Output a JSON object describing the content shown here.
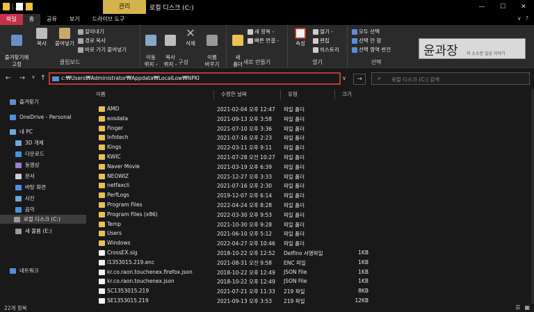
{
  "titlebar": {
    "manage_tab": "관리",
    "title": "로컬 디스크 (C:)",
    "minimize": "—",
    "maximize": "☐",
    "close": "✕"
  },
  "tabs": [
    "파일",
    "홈",
    "공유",
    "보기",
    "드라이브 도구"
  ],
  "ribbon_right": {
    "collapse": "∨",
    "help": "?"
  },
  "ribbon": {
    "clipboard": {
      "pin": "즐겨찾기에\n고정",
      "copy": "복사",
      "paste": "붙여넣기",
      "cut": "잘라내기",
      "copy_path": "경로 복사",
      "paste_shortcut": "바로 가기 붙여넣기",
      "label": "클립보드"
    },
    "organize": {
      "move_to": "이동\n위치 -",
      "copy_to": "복사\n위치 -",
      "delete": "삭제",
      "rename": "이름\n바꾸기",
      "label": "구성"
    },
    "new": {
      "new_folder": "새\n폴더",
      "new_item": "새 항목 -",
      "easy_access": "빠른 연결 -",
      "label": "새로 만들기"
    },
    "open": {
      "properties": "속성",
      "open": "열기 -",
      "edit": "편집",
      "history": "히스토리",
      "label": "열기"
    },
    "select": {
      "select_all": "모두 선택",
      "select_none": "선택 안 함",
      "invert": "선택 영역 반전",
      "label": "선택"
    }
  },
  "logo": {
    "main": "윤과장",
    "sub": "의 소소한 일상 이야기"
  },
  "address": {
    "back": "←",
    "forward": "→",
    "recent": "∨",
    "up": "↑",
    "path": "c:₩Users₩Administrator₩Appdata₩LocalLow₩NPKI",
    "dropdown": "∨",
    "go": "→",
    "search_placeholder": "로컬 디스크 (C:) 검색"
  },
  "nav": {
    "quick_access": "즐겨찾기",
    "onedrive": "OneDrive - Personal",
    "this_pc": "내 PC",
    "objects3d": "3D 개체",
    "downloads": "다운로드",
    "videos": "동영상",
    "documents": "문서",
    "desktop": "바탕 화면",
    "pictures": "사진",
    "music": "음악",
    "local_disk": "로컬 디스크 (C:)",
    "new_volume": "새 볼륨 (E:)",
    "network": "네트워크"
  },
  "columns": {
    "name": "이름",
    "date": "수정한 날짜",
    "type": "유형",
    "size": "크기"
  },
  "files": [
    {
      "name": "AMD",
      "date": "2021-02-04 오후 12:47",
      "type": "파일 폴더",
      "size": "",
      "kind": "folder"
    },
    {
      "name": "eosdata",
      "date": "2021-09-13 오후 3:58",
      "type": "파일 폴더",
      "size": "",
      "kind": "folder"
    },
    {
      "name": "Finger",
      "date": "2021-07-10 오후 3:36",
      "type": "파일 폴더",
      "size": "",
      "kind": "folder"
    },
    {
      "name": "Infotech",
      "date": "2021-07-16 오후 2:23",
      "type": "파일 폴더",
      "size": "",
      "kind": "folder"
    },
    {
      "name": "Kings",
      "date": "2022-03-11 오후 9:11",
      "type": "파일 폴더",
      "size": "",
      "kind": "folder"
    },
    {
      "name": "KWIC",
      "date": "2021-07-28 오전 10:27",
      "type": "파일 폴더",
      "size": "",
      "kind": "folder"
    },
    {
      "name": "Naver Movie",
      "date": "2021-03-19 오후 6:39",
      "type": "파일 폴더",
      "size": "",
      "kind": "folder"
    },
    {
      "name": "NEOWIZ",
      "date": "2021-12-27 오후 3:33",
      "type": "파일 폴더",
      "size": "",
      "kind": "folder"
    },
    {
      "name": "netfaxcli",
      "date": "2021-07-16 오후 2:30",
      "type": "파일 폴더",
      "size": "",
      "kind": "folder"
    },
    {
      "name": "PerfLogs",
      "date": "2019-12-07 오후 6:14",
      "type": "파일 폴더",
      "size": "",
      "kind": "folder"
    },
    {
      "name": "Program Files",
      "date": "2022-04-24 오후 8:28",
      "type": "파일 폴더",
      "size": "",
      "kind": "folder"
    },
    {
      "name": "Program Files (x86)",
      "date": "2022-03-30 오후 9:53",
      "type": "파일 폴더",
      "size": "",
      "kind": "folder"
    },
    {
      "name": "Temp",
      "date": "2021-10-30 오후 9:28",
      "type": "파일 폴더",
      "size": "",
      "kind": "folder"
    },
    {
      "name": "Users",
      "date": "2021-06-10 오후 5:12",
      "type": "파일 폴더",
      "size": "",
      "kind": "folder"
    },
    {
      "name": "Windows",
      "date": "2022-04-27 오후 10:46",
      "type": "파일 폴더",
      "size": "",
      "kind": "folder"
    },
    {
      "name": "CrossEX.sig",
      "date": "2018-10-22 오후 12:52",
      "type": "Delfino 서명파일",
      "size": "1KB",
      "kind": "file"
    },
    {
      "name": "I1353015.219.enc",
      "date": "2021-08-31 오전 9:58",
      "type": "ENC 파일",
      "size": "1KB",
      "kind": "file"
    },
    {
      "name": "kr.co.raon.touchenex.firefox.json",
      "date": "2018-10-22 오후 12:49",
      "type": "JSON File",
      "size": "1KB",
      "kind": "file"
    },
    {
      "name": "kr.co.raon.touchenex.json",
      "date": "2018-10-22 오후 12:49",
      "type": "JSON File",
      "size": "1KB",
      "kind": "file"
    },
    {
      "name": "SC1353015.219",
      "date": "2021-07-21 오후 11:33",
      "type": "219 파일",
      "size": "8KB",
      "kind": "file"
    },
    {
      "name": "SE1353015.219",
      "date": "2021-09-13 오후 3:53",
      "type": "219 파일",
      "size": "12KB",
      "kind": "file"
    }
  ],
  "status": {
    "count": "22개 항목",
    "view_details": "☰",
    "view_icons": "▦"
  }
}
